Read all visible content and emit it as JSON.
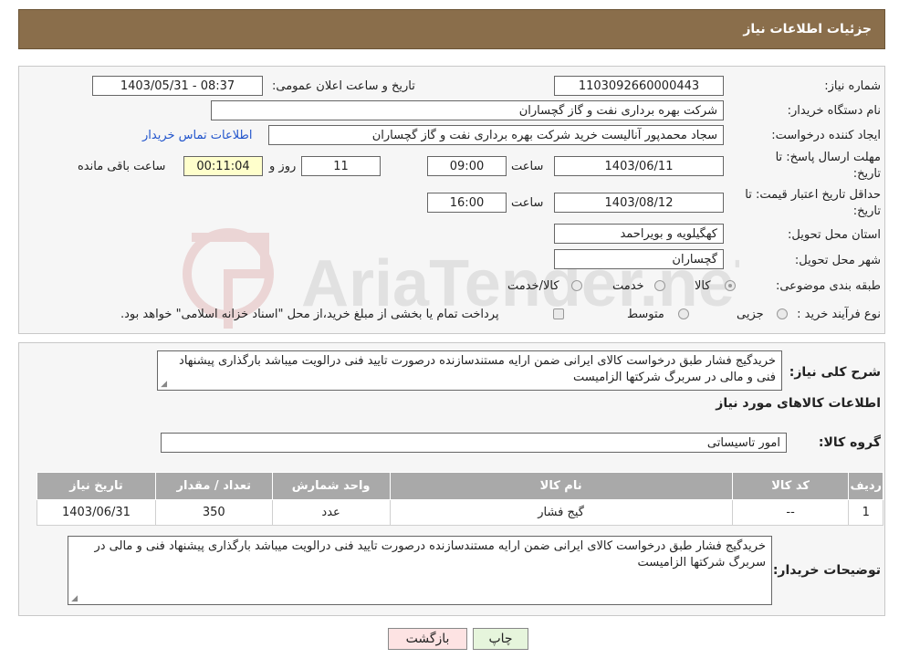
{
  "header": {
    "title": "جزئیات اطلاعات نیاز"
  },
  "form": {
    "need_number_label": "شماره نیاز:",
    "need_number": "1103092660000443",
    "announce_label": "تاریخ و ساعت اعلان عمومی:",
    "announce_value": "1403/05/31 - 08:37",
    "buyer_org_label": "نام دستگاه خریدار:",
    "buyer_org": "شرکت بهره برداری نفت و گاز گچساران",
    "creator_label": "ایجاد کننده درخواست:",
    "creator": "سجاد محمدپور آنالیست خرید شرکت بهره برداری نفت و گاز گچساران",
    "contact_link": "اطلاعات تماس خریدار",
    "deadline_label_1": "مهلت ارسال پاسخ: تا",
    "deadline_label_2": "تاریخ:",
    "deadline_date": "1403/06/11",
    "time_label": "ساعت",
    "deadline_time": "09:00",
    "days_value": "11",
    "days_label": "روز و",
    "remaining_time": "00:11:04",
    "remaining_label": "ساعت باقی مانده",
    "validity_label_1": "حداقل تاریخ اعتبار قیمت: تا",
    "validity_label_2": "تاریخ:",
    "validity_date": "1403/08/12",
    "validity_time": "16:00",
    "province_label": "استان محل تحویل:",
    "province": "کهگیلویه و بویراحمد",
    "city_label": "شهر محل تحویل:",
    "city": "گچساران",
    "category_label": "طبقه بندی موضوعی:",
    "category_options": [
      "کالا",
      "خدمت",
      "کالا/خدمت"
    ],
    "process_label": "نوع فرآیند خرید :",
    "process_options": [
      "جزیی",
      "متوسط"
    ],
    "payment_note": "پرداخت تمام یا بخشی از مبلغ خرید،از محل \"اسناد خزانه اسلامی\" خواهد بود."
  },
  "details": {
    "summary_label": "شرح کلی نیاز:",
    "summary": "خریدگیج فشار طبق درخواست کالای ایرانی ضمن ارایه مستندسازنده درصورت تایید فنی درالویت میباشد بارگذاری پیشنهاد فنی و مالی در سربرگ شرکتها الزامیست",
    "goods_info_title": "اطلاعات کالاهای مورد نیاز",
    "group_label": "گروه کالا:",
    "group_value": "امور تاسیساتی"
  },
  "table": {
    "headers": [
      "ردیف",
      "کد کالا",
      "نام کالا",
      "واحد شمارش",
      "تعداد / مقدار",
      "تاریخ نیاز"
    ],
    "rows": [
      [
        "1",
        "--",
        "گیج فشار",
        "عدد",
        "350",
        "1403/06/31"
      ]
    ]
  },
  "buyer_notes": {
    "label": "توضیحات خریدار:",
    "text": "خریدگیج فشار طبق درخواست کالای ایرانی ضمن ارایه مستندسازنده درصورت تایید فنی درالویت میباشد بارگذاری پیشنهاد فنی و مالی در سربرگ شرکتها الزامیست"
  },
  "buttons": {
    "print": "چاپ",
    "back": "بازگشت"
  },
  "watermark": "AriaTender.neT",
  "colors": {
    "header_bg": "#8a6e4b",
    "table_header_bg": "#a9a9a9",
    "print_btn": "#e6f5dc",
    "back_btn": "#fde3e3",
    "link": "#2255cc"
  }
}
